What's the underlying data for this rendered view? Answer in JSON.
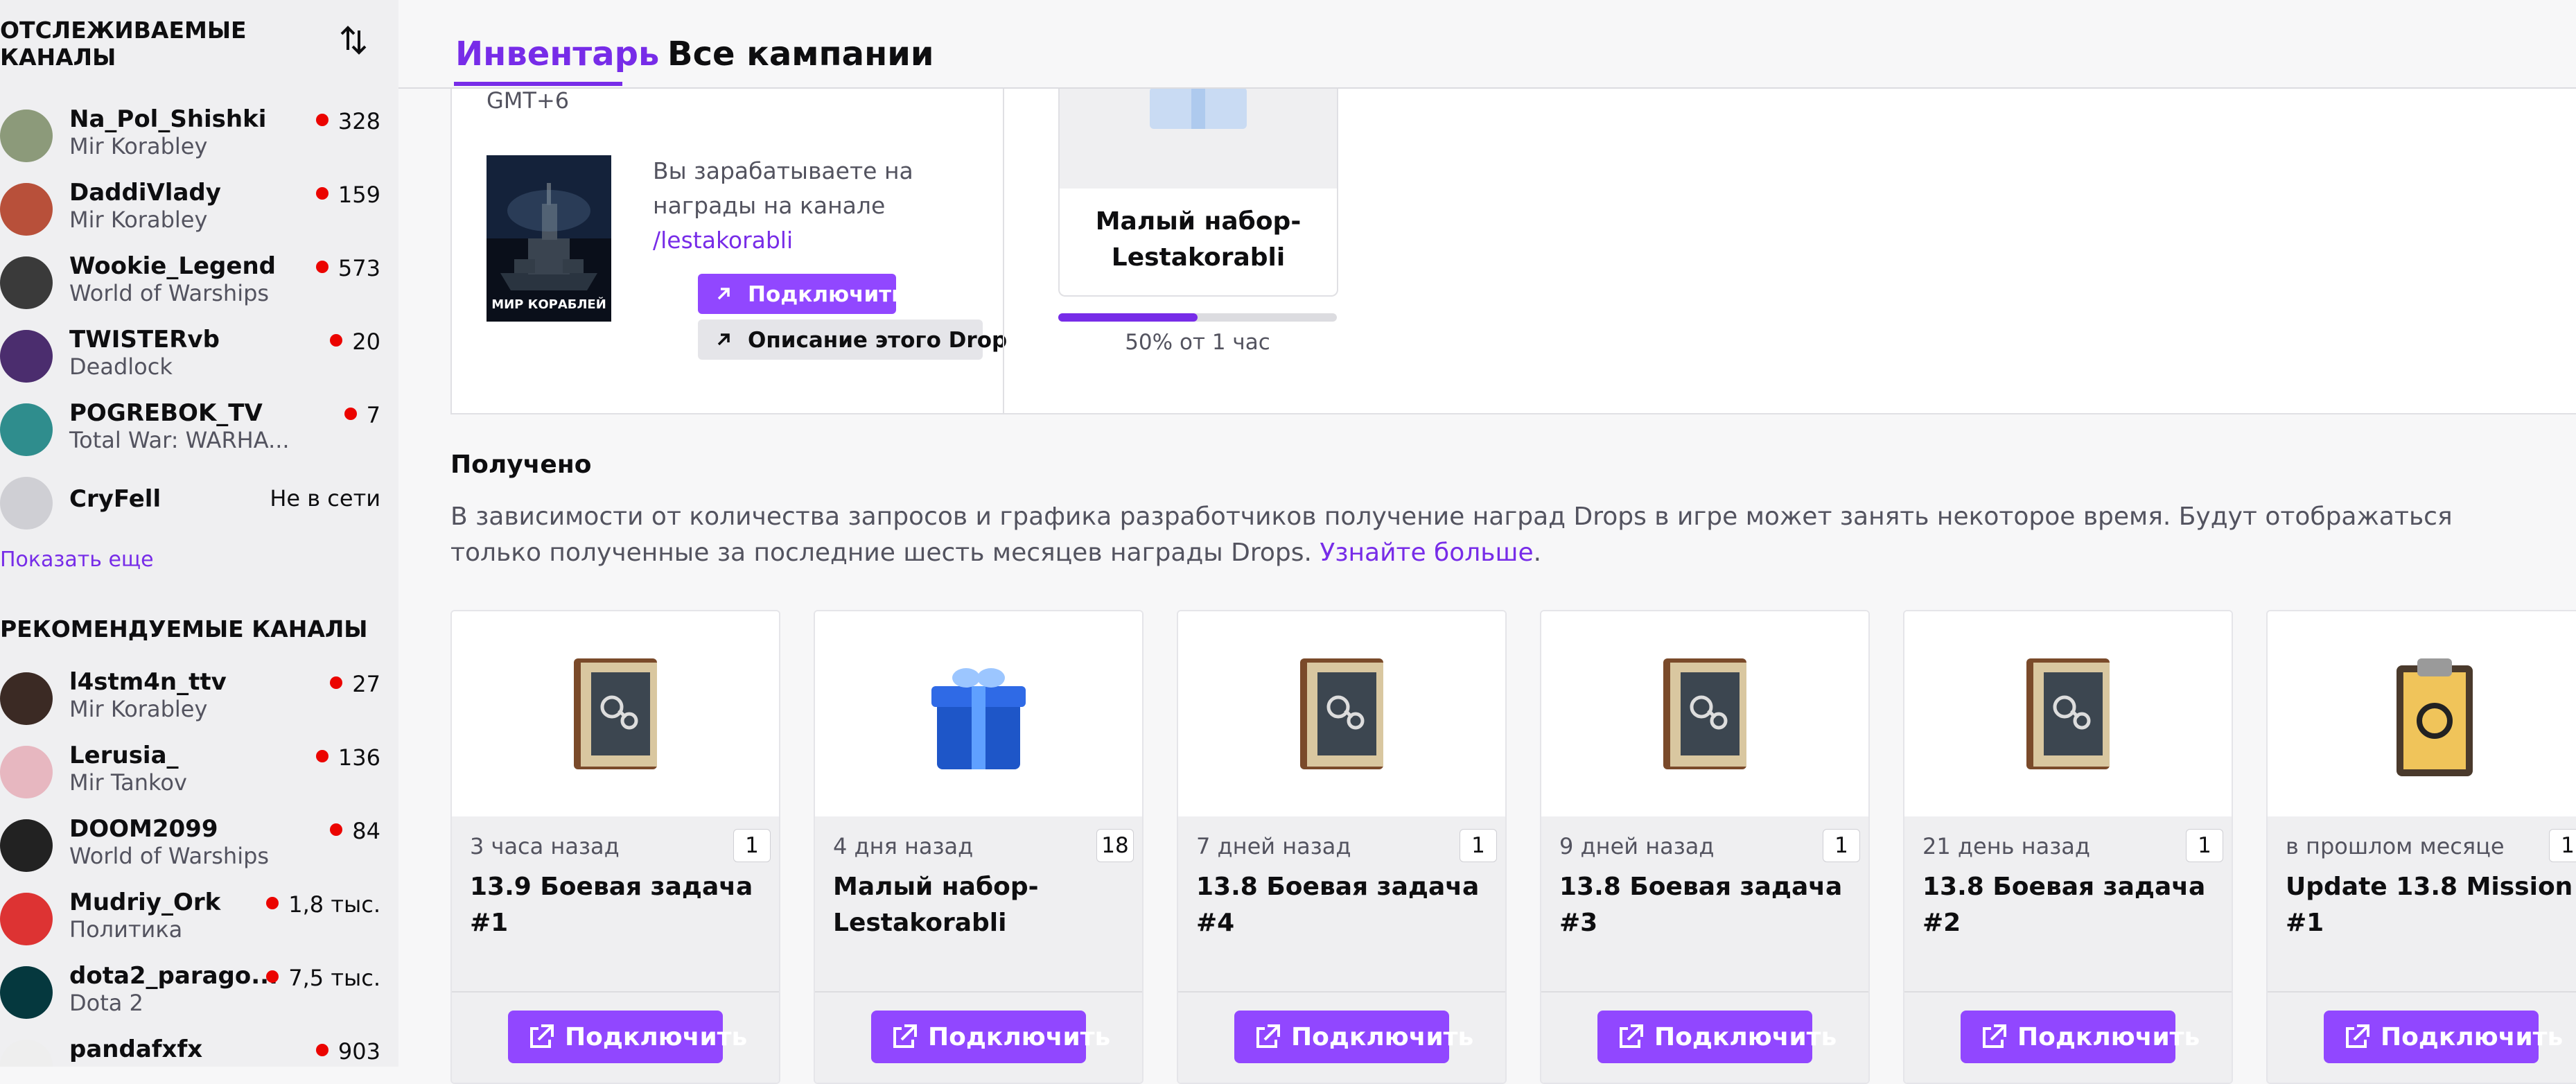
{
  "sidebar": {
    "followed_title_line1": "ОТСЛЕЖИВАЕМЫЕ",
    "followed_title_line2": "КАНАЛЫ",
    "followed": [
      {
        "name": "Na_Pol_Shishki",
        "game": "Mir Korabley",
        "viewers": "328",
        "live": true
      },
      {
        "name": "DaddiVlady",
        "game": "Mir Korabley",
        "viewers": "159",
        "live": true
      },
      {
        "name": "Wookie_Legend",
        "game": "World of Warships",
        "viewers": "573",
        "live": true
      },
      {
        "name": "TWISTERvb",
        "game": "Deadlock",
        "viewers": "20",
        "live": true
      },
      {
        "name": "POGREBOK_TV",
        "game": "Total War: WARHA...",
        "viewers": "7",
        "live": true
      },
      {
        "name": "CryFell",
        "game": "",
        "viewers": "Не в сети",
        "live": false
      }
    ],
    "show_more": "Показать еще",
    "recommended_title": "РЕКОМЕНДУЕМЫЕ КАНАЛЫ",
    "recommended": [
      {
        "name": "l4stm4n_ttv",
        "game": "Mir Korabley",
        "viewers": "27"
      },
      {
        "name": "Lerusia_",
        "game": "Mir Tankov",
        "viewers": "136"
      },
      {
        "name": "DOOM2099",
        "game": "World of Warships",
        "viewers": "84"
      },
      {
        "name": "Mudriy_Ork",
        "game": "Политика",
        "viewers": "1,8 тыс."
      },
      {
        "name": "dota2_parago...",
        "game": "Dota 2",
        "viewers": "7,5 тыс."
      },
      {
        "name": "pandafxfx",
        "game": "",
        "viewers": "903"
      }
    ]
  },
  "tabs": {
    "inventory": "Инвентарь",
    "campaigns": "Все кампании"
  },
  "campaign": {
    "timezone": "GMT+6",
    "cover_title": "МИР КОРАБЛЕЙ",
    "earn_text": "Вы зарабатываете на награды на канале",
    "earn_link": "/lestakorabli",
    "connect_label": "Подключить",
    "about_label": "Описание этого Drop",
    "reward_name": "Малый набор-Lestakorabli",
    "progress": 0.5,
    "progress_text": "50% от 1 час"
  },
  "received": {
    "title": "Получено",
    "description": "В зависимости от количества запросов и графика разработчиков получение наград Drops в игре может занять некоторое время. Будут отображаться только полученные за последние шесть месяцев награды Drops.",
    "learn_more": "Узнайте больше",
    "learn_more_suffix": ".",
    "button_label": "Подключить",
    "items": [
      {
        "when": "3 часа назад",
        "count": "1",
        "name": "13.9 Боевая задача #1",
        "icon": "book-icon"
      },
      {
        "when": "4 дня назад",
        "count": "18",
        "name": "Малый набор-Lestakorabli",
        "icon": "gift-icon"
      },
      {
        "when": "7 дней назад",
        "count": "1",
        "name": "13.8 Боевая задача #4",
        "icon": "book-icon"
      },
      {
        "when": "9 дней назад",
        "count": "1",
        "name": "13.8 Боевая задача #3",
        "icon": "book-icon"
      },
      {
        "when": "21 день назад",
        "count": "1",
        "name": "13.8 Боевая задача #2",
        "icon": "book-icon"
      },
      {
        "when": "в прошлом месяце",
        "count": "1",
        "name": "Update 13.8 Mission #1",
        "icon": "clipboard-icon"
      }
    ]
  },
  "colors": {
    "accent": "#772ce8",
    "button": "#9147ff",
    "live": "#eb0400"
  }
}
